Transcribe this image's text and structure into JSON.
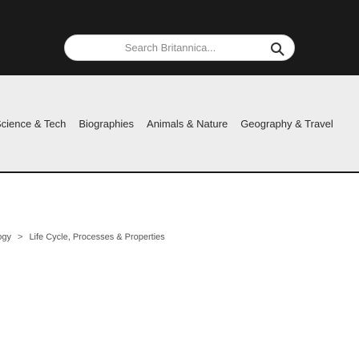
{
  "search": {
    "placeholder": "Search Britannica...",
    "icon": "search-icon"
  },
  "nav": {
    "items": [
      {
        "label": "Science & Tech"
      },
      {
        "label": "Biographies"
      },
      {
        "label": "Animals & Nature"
      },
      {
        "label": "Geography & Travel"
      }
    ]
  },
  "breadcrumb": {
    "items": [
      {
        "label": "Biology"
      },
      {
        "label": "Life Cycle, Processes & Properties"
      }
    ],
    "separator": ">"
  },
  "colors": {
    "header_bg": "#1a1a1a",
    "nav_bg": "#ededed",
    "page_bg": "#ffffff"
  }
}
